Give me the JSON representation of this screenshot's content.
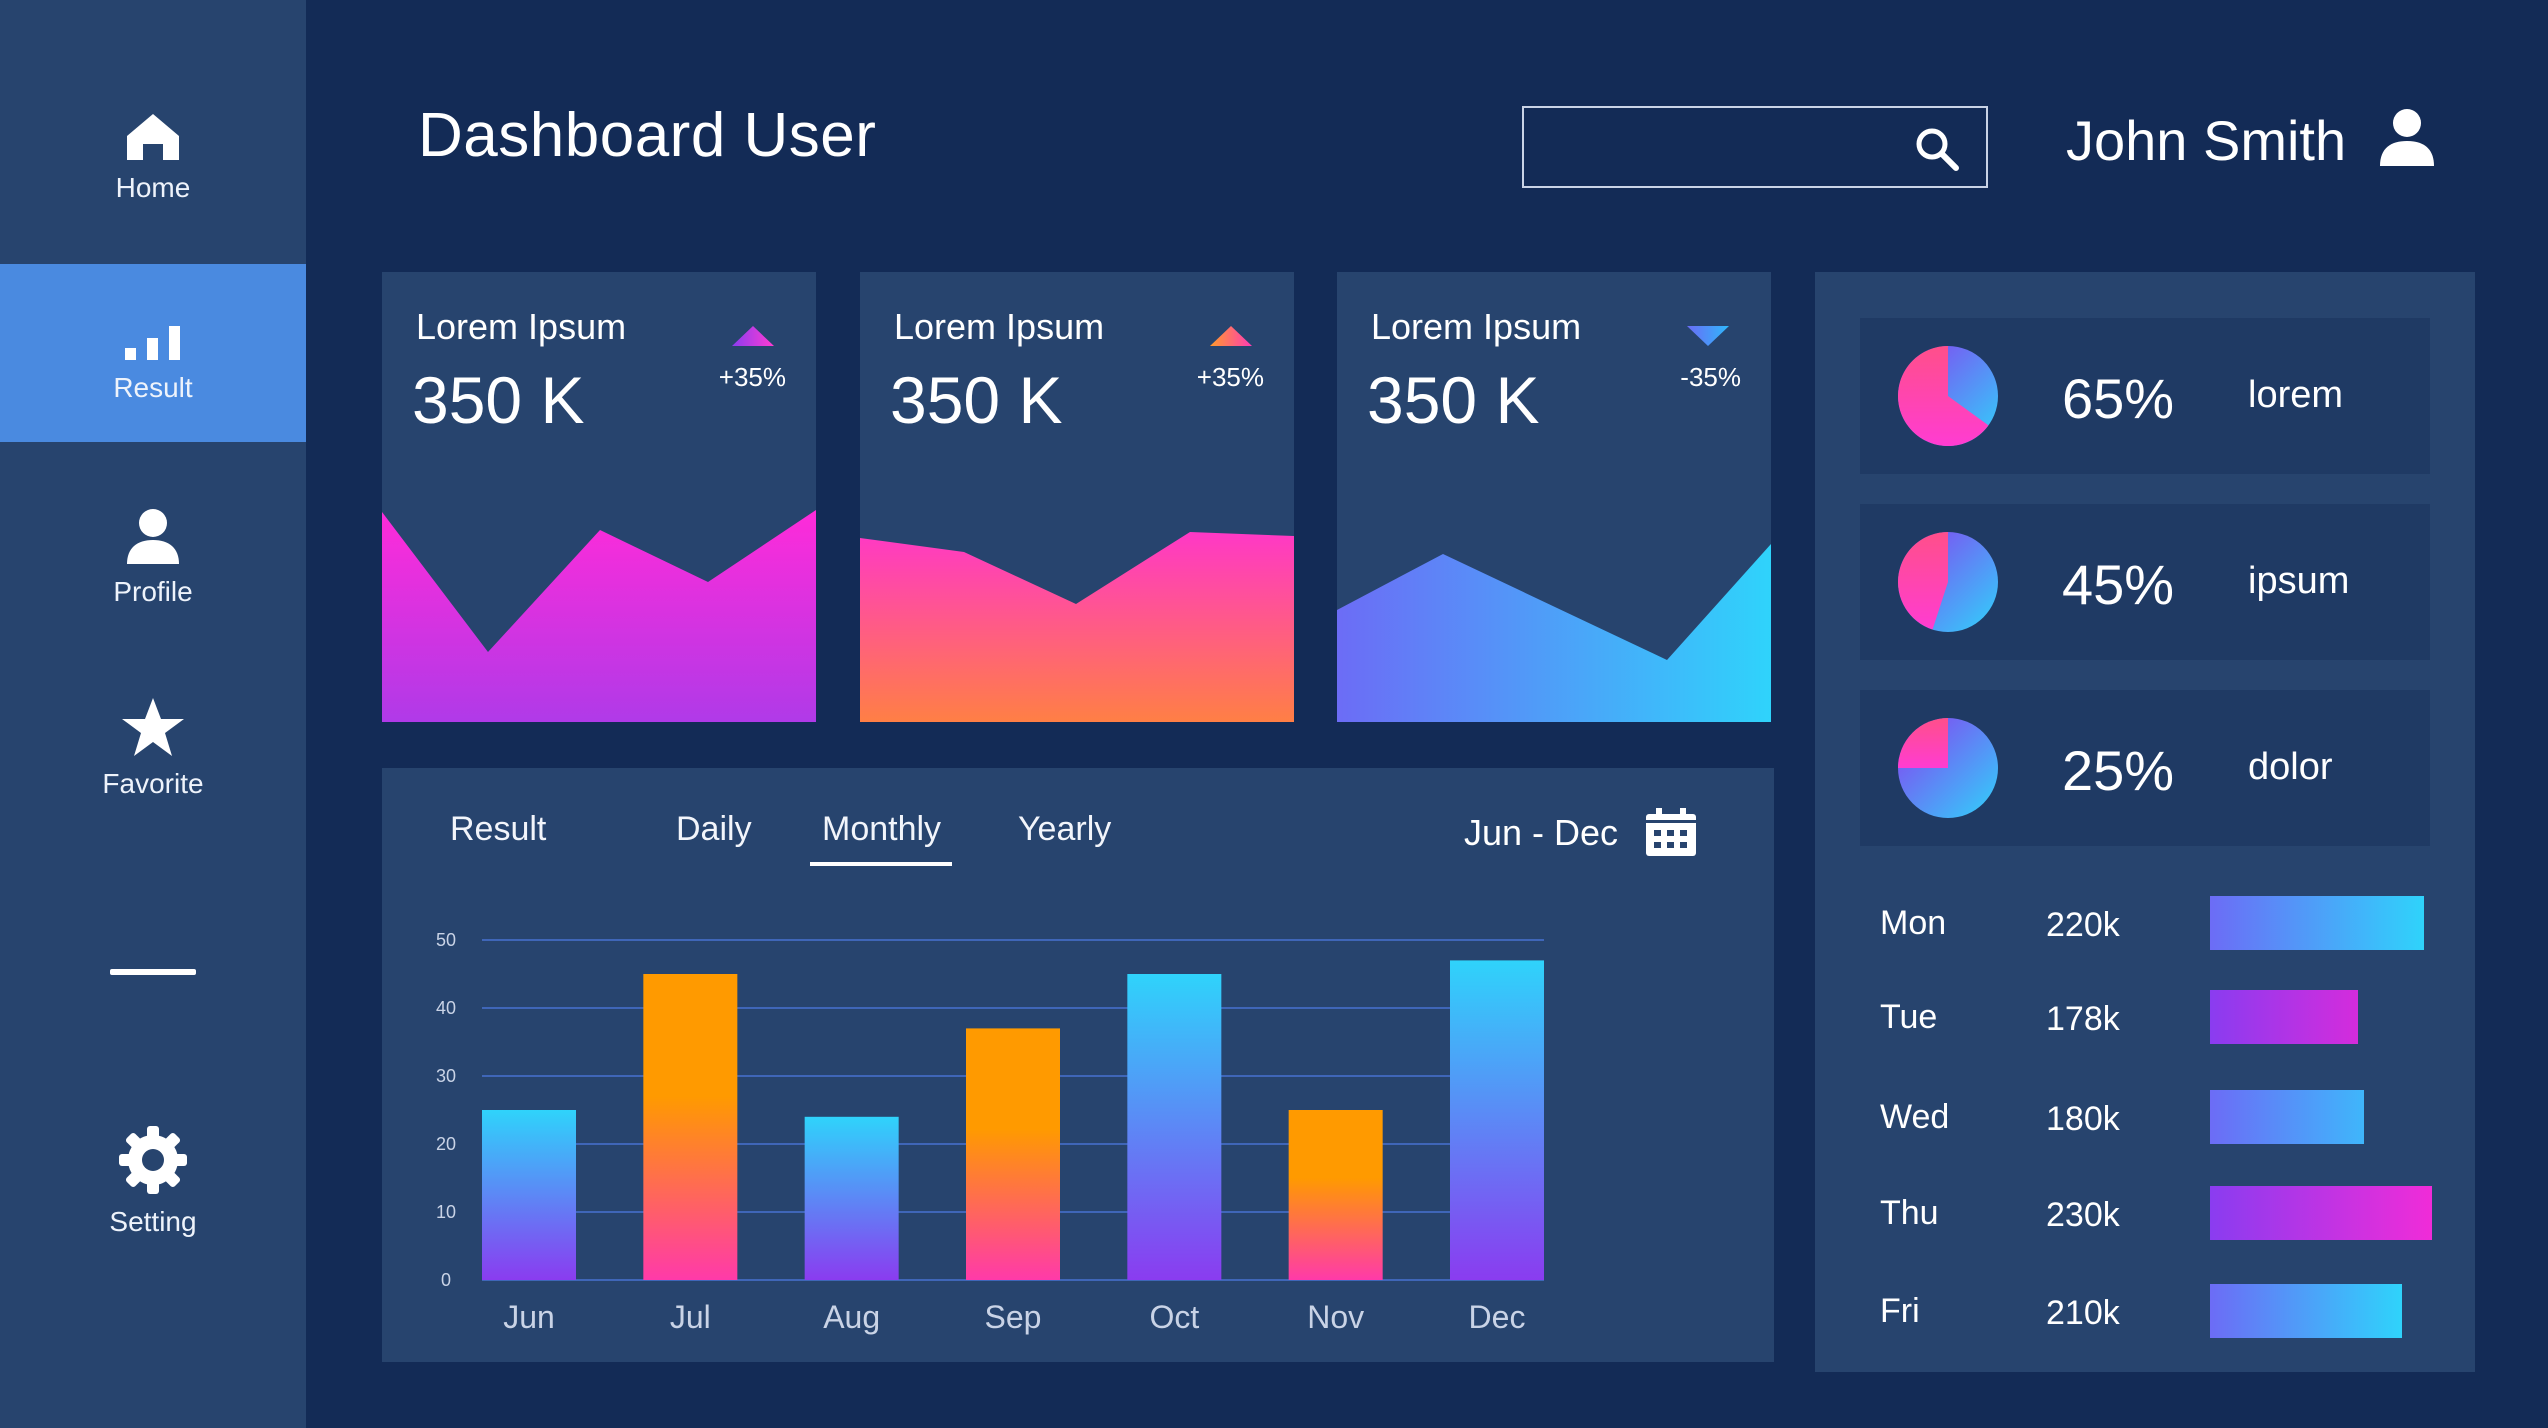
{
  "sidebar": {
    "items": [
      {
        "label": "Home",
        "icon": "home-icon"
      },
      {
        "label": "Result",
        "icon": "bar-chart-icon",
        "active": true
      },
      {
        "label": "Profile",
        "icon": "person-icon"
      },
      {
        "label": "Favorite",
        "icon": "star-icon"
      },
      {
        "label": "Setting",
        "icon": "gear-icon"
      }
    ]
  },
  "header": {
    "title": "Dashboard User",
    "search_placeholder": "",
    "user_name": "John Smith"
  },
  "cards": [
    {
      "label": "Lorem Ipsum",
      "value": "350 K",
      "change": "+35%",
      "trend": "up"
    },
    {
      "label": "Lorem Ipsum",
      "value": "350 K",
      "change": "+35%",
      "trend": "up"
    },
    {
      "label": "Lorem Ipsum",
      "value": "350 K",
      "change": "-35%",
      "trend": "down"
    }
  ],
  "chart_panel": {
    "title_tab": "Result",
    "tabs": [
      "Daily",
      "Monthly",
      "Yearly"
    ],
    "active_tab": "Monthly",
    "range": "Jun - Dec"
  },
  "chart_data": {
    "type": "bar",
    "categories": [
      "Jun",
      "Jul",
      "Aug",
      "Sep",
      "Oct",
      "Nov",
      "Dec"
    ],
    "values": [
      25,
      45,
      24,
      37,
      45,
      25,
      47
    ],
    "yticks": [
      0,
      10,
      20,
      30,
      40,
      50
    ],
    "ylim": [
      0,
      50
    ],
    "grid": true,
    "colors": {
      "blue_top": "#2fd3fb",
      "blue_bottom": "#8a3cf0",
      "orange_top": "#ff9a00",
      "orange_bottom": "#ff3aa9"
    }
  },
  "pie_stats": [
    {
      "percent": "65%",
      "label": "lorem",
      "value": 65
    },
    {
      "percent": "45%",
      "label": "ipsum",
      "value": 45
    },
    {
      "percent": "25%",
      "label": "dolor",
      "value": 25
    }
  ],
  "day_stats": [
    {
      "day": "Mon",
      "value": "220k"
    },
    {
      "day": "Tue",
      "value": "178k"
    },
    {
      "day": "Wed",
      "value": "180k"
    },
    {
      "day": "Thu",
      "value": "230k"
    },
    {
      "day": "Fri",
      "value": "210k"
    }
  ],
  "colors": {
    "background": "#132b56",
    "panel": "#27446e",
    "active_nav": "#4a8ae0",
    "accent_pink": "#ff3cd2",
    "accent_blue": "#2fd3fb"
  }
}
